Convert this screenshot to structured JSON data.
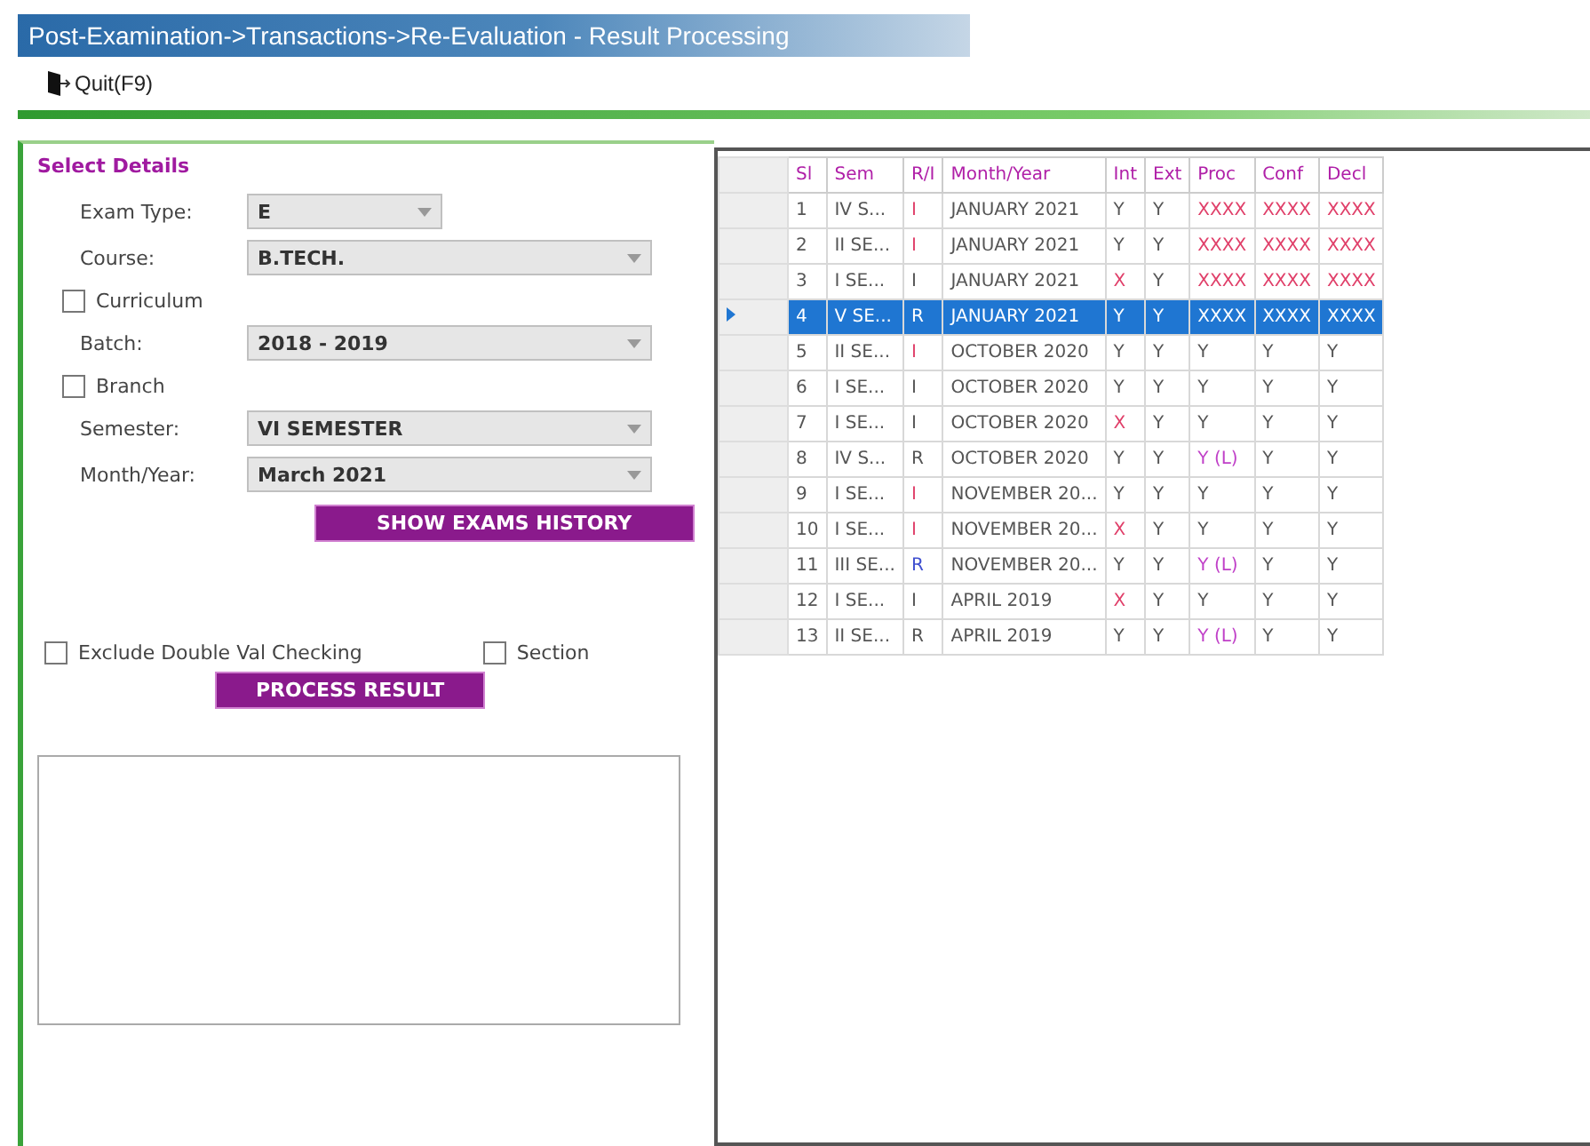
{
  "window": {
    "title": "Post-Examination->Transactions->Re-Evaluation - Result Processing"
  },
  "toolbar": {
    "quit_label": "Quit(F9)"
  },
  "form": {
    "title": "Select Details",
    "fields": [
      {
        "kind": "select",
        "label": "Exam Type:",
        "value": "E",
        "short": true
      },
      {
        "kind": "select",
        "label": "Course:",
        "value": "B.TECH."
      },
      {
        "kind": "checkbox",
        "label": "Curriculum",
        "checked": false
      },
      {
        "kind": "select",
        "label": "Batch:",
        "value": "2018 - 2019"
      },
      {
        "kind": "checkbox",
        "label": "Branch",
        "checked": false
      },
      {
        "kind": "select",
        "label": "Semester:",
        "value": "VI SEMESTER"
      },
      {
        "kind": "select",
        "label": "Month/Year:",
        "value": "March 2021"
      }
    ],
    "history_button": "SHOW EXAMS HISTORY",
    "exclude_check": {
      "label": "Exclude Double Val Checking",
      "checked": false
    },
    "section_check": {
      "label": "Section",
      "checked": false
    },
    "process_button": "PROCESS RESULT"
  },
  "grid": {
    "columns": [
      "Sl",
      "Sem",
      "R/I",
      "Month/Year",
      "Int",
      "Ext",
      "Proc",
      "Conf",
      "Decl"
    ],
    "rows": [
      {
        "selected": false,
        "cells": [
          {
            "text": "1"
          },
          {
            "text": "IV S..."
          },
          {
            "text": "I",
            "color": "#e0406a"
          },
          {
            "text": "JANUARY 2021"
          },
          {
            "text": "Y"
          },
          {
            "text": "Y"
          },
          {
            "text": "XXXX",
            "color": "#e0406a"
          },
          {
            "text": "XXXX",
            "color": "#e0406a"
          },
          {
            "text": "XXXX",
            "color": "#e0406a"
          }
        ]
      },
      {
        "selected": false,
        "cells": [
          {
            "text": "2"
          },
          {
            "text": "II SE..."
          },
          {
            "text": "I",
            "color": "#e0406a"
          },
          {
            "text": "JANUARY 2021"
          },
          {
            "text": "Y"
          },
          {
            "text": "Y"
          },
          {
            "text": "XXXX",
            "color": "#e0406a"
          },
          {
            "text": "XXXX",
            "color": "#e0406a"
          },
          {
            "text": "XXXX",
            "color": "#e0406a"
          }
        ]
      },
      {
        "selected": false,
        "cells": [
          {
            "text": "3"
          },
          {
            "text": "I SE..."
          },
          {
            "text": "I"
          },
          {
            "text": "JANUARY 2021"
          },
          {
            "text": "X",
            "color": "#e0406a"
          },
          {
            "text": "Y"
          },
          {
            "text": "XXXX",
            "color": "#e0406a"
          },
          {
            "text": "XXXX",
            "color": "#e0406a"
          },
          {
            "text": "XXXX",
            "color": "#e0406a"
          }
        ]
      },
      {
        "selected": true,
        "cells": [
          {
            "text": "4"
          },
          {
            "text": "V SE..."
          },
          {
            "text": "R"
          },
          {
            "text": "JANUARY 2021"
          },
          {
            "text": "Y"
          },
          {
            "text": "Y"
          },
          {
            "text": "XXXX"
          },
          {
            "text": "XXXX"
          },
          {
            "text": "XXXX"
          }
        ]
      },
      {
        "selected": false,
        "cells": [
          {
            "text": "5"
          },
          {
            "text": "II SE..."
          },
          {
            "text": "I",
            "color": "#e0406a"
          },
          {
            "text": "OCTOBER 2020"
          },
          {
            "text": "Y"
          },
          {
            "text": "Y"
          },
          {
            "text": "Y"
          },
          {
            "text": "Y"
          },
          {
            "text": "Y"
          }
        ]
      },
      {
        "selected": false,
        "cells": [
          {
            "text": "6"
          },
          {
            "text": "I SE..."
          },
          {
            "text": "I"
          },
          {
            "text": "OCTOBER 2020"
          },
          {
            "text": "Y"
          },
          {
            "text": "Y"
          },
          {
            "text": "Y"
          },
          {
            "text": "Y"
          },
          {
            "text": "Y"
          }
        ]
      },
      {
        "selected": false,
        "cells": [
          {
            "text": "7"
          },
          {
            "text": "I SE..."
          },
          {
            "text": "I"
          },
          {
            "text": "OCTOBER 2020"
          },
          {
            "text": "X",
            "color": "#e0406a"
          },
          {
            "text": "Y"
          },
          {
            "text": "Y"
          },
          {
            "text": "Y"
          },
          {
            "text": "Y"
          }
        ]
      },
      {
        "selected": false,
        "cells": [
          {
            "text": "8"
          },
          {
            "text": "IV S..."
          },
          {
            "text": "R"
          },
          {
            "text": "OCTOBER 2020"
          },
          {
            "text": "Y"
          },
          {
            "text": "Y"
          },
          {
            "text": "Y (L)",
            "color": "#c040c8"
          },
          {
            "text": "Y"
          },
          {
            "text": "Y"
          }
        ]
      },
      {
        "selected": false,
        "cells": [
          {
            "text": "9"
          },
          {
            "text": "I SE..."
          },
          {
            "text": "I",
            "color": "#e0406a"
          },
          {
            "text": "NOVEMBER 20..."
          },
          {
            "text": "Y"
          },
          {
            "text": "Y"
          },
          {
            "text": "Y"
          },
          {
            "text": "Y"
          },
          {
            "text": "Y"
          }
        ]
      },
      {
        "selected": false,
        "cells": [
          {
            "text": "10"
          },
          {
            "text": "I SE..."
          },
          {
            "text": "I",
            "color": "#e0406a"
          },
          {
            "text": "NOVEMBER 20..."
          },
          {
            "text": "X",
            "color": "#e0406a"
          },
          {
            "text": "Y"
          },
          {
            "text": "Y"
          },
          {
            "text": "Y"
          },
          {
            "text": "Y"
          }
        ]
      },
      {
        "selected": false,
        "cells": [
          {
            "text": "11"
          },
          {
            "text": "III SE..."
          },
          {
            "text": "R",
            "color": "#4050d0"
          },
          {
            "text": "NOVEMBER 20..."
          },
          {
            "text": "Y"
          },
          {
            "text": "Y"
          },
          {
            "text": "Y (L)",
            "color": "#c040c8"
          },
          {
            "text": "Y"
          },
          {
            "text": "Y"
          }
        ]
      },
      {
        "selected": false,
        "cells": [
          {
            "text": "12"
          },
          {
            "text": "I SE..."
          },
          {
            "text": "I"
          },
          {
            "text": "APRIL 2019"
          },
          {
            "text": "X",
            "color": "#e0406a"
          },
          {
            "text": "Y"
          },
          {
            "text": "Y"
          },
          {
            "text": "Y"
          },
          {
            "text": "Y"
          }
        ]
      },
      {
        "selected": false,
        "cells": [
          {
            "text": "13"
          },
          {
            "text": "II SE..."
          },
          {
            "text": "R"
          },
          {
            "text": "APRIL 2019"
          },
          {
            "text": "Y"
          },
          {
            "text": "Y"
          },
          {
            "text": "Y (L)",
            "color": "#c040c8"
          },
          {
            "text": "Y"
          },
          {
            "text": "Y"
          }
        ]
      }
    ]
  }
}
